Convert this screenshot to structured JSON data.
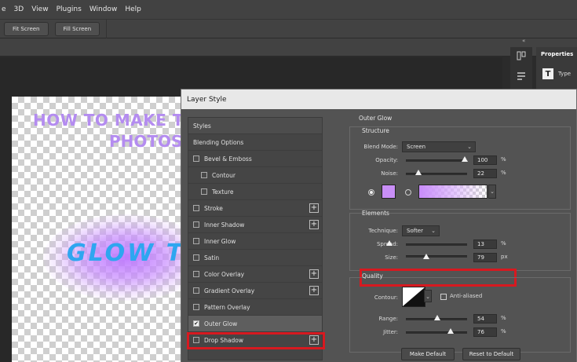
{
  "menu": [
    "e",
    "3D",
    "View",
    "Plugins",
    "Window",
    "Help"
  ],
  "options": {
    "fit_screen": "Fit Screen",
    "fill_screen": "Fill Screen"
  },
  "canvas": {
    "headline1": "HOW TO MAKE T",
    "headline2": "PHOTOS",
    "glow_text": "GLOW T"
  },
  "right_panel": {
    "title": "Properties",
    "type_label": "Type",
    "collapse_glyph": "«"
  },
  "dialog": {
    "title": "Layer Style",
    "styles_header": "Styles",
    "blending_options": "Blending Options",
    "items": [
      {
        "label": "Bevel & Emboss",
        "checked": false,
        "plus": false,
        "indent": false
      },
      {
        "label": "Contour",
        "checked": false,
        "plus": false,
        "indent": true
      },
      {
        "label": "Texture",
        "checked": false,
        "plus": false,
        "indent": true
      },
      {
        "label": "Stroke",
        "checked": false,
        "plus": true,
        "indent": false
      },
      {
        "label": "Inner Shadow",
        "checked": false,
        "plus": true,
        "indent": false
      },
      {
        "label": "Inner Glow",
        "checked": false,
        "plus": false,
        "indent": false
      },
      {
        "label": "Satin",
        "checked": false,
        "plus": false,
        "indent": false
      },
      {
        "label": "Color Overlay",
        "checked": false,
        "plus": true,
        "indent": false
      },
      {
        "label": "Gradient Overlay",
        "checked": false,
        "plus": true,
        "indent": false
      },
      {
        "label": "Pattern Overlay",
        "checked": false,
        "plus": false,
        "indent": false
      },
      {
        "label": "Outer Glow",
        "checked": true,
        "plus": false,
        "indent": false
      },
      {
        "label": "Drop Shadow",
        "checked": false,
        "plus": true,
        "indent": false
      }
    ],
    "outer_glow": {
      "title": "Outer Glow",
      "structure": {
        "label": "Structure",
        "blend_mode_label": "Blend Mode:",
        "blend_mode": "Screen",
        "opacity_label": "Opacity:",
        "opacity": "100",
        "noise_label": "Noise:",
        "noise": "22",
        "percent": "%",
        "color": "#c98ff7"
      },
      "elements": {
        "label": "Elements",
        "technique_label": "Technique:",
        "technique": "Softer",
        "spread_label": "Spread:",
        "spread": "13",
        "size_label": "Size:",
        "size": "79",
        "size_unit": "px"
      },
      "quality": {
        "label": "Quality",
        "contour_label": "Contour:",
        "anti_aliased_label": "Anti-aliased",
        "range_label": "Range:",
        "range": "54",
        "jitter_label": "Jitter:",
        "jitter": "76"
      },
      "make_default": "Make Default",
      "reset_default": "Reset to Default"
    }
  },
  "highlight_color": "#d71920"
}
